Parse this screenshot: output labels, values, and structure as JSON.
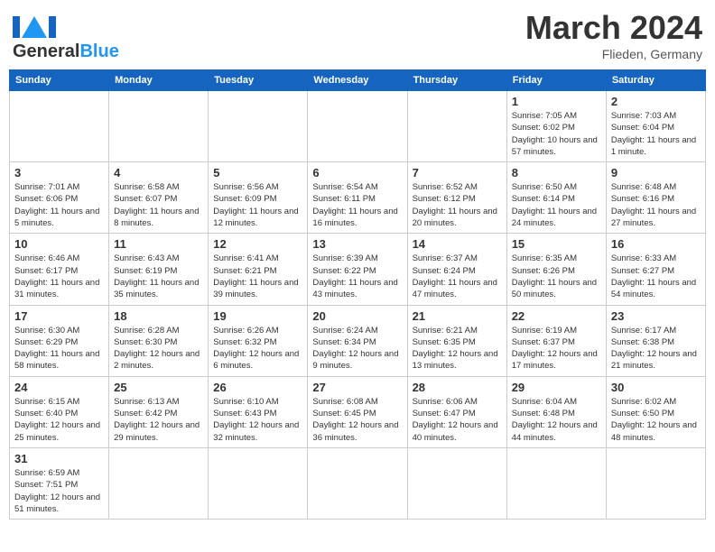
{
  "header": {
    "logo_general": "General",
    "logo_blue": "Blue",
    "month": "March 2024",
    "location": "Flieden, Germany"
  },
  "weekdays": [
    "Sunday",
    "Monday",
    "Tuesday",
    "Wednesday",
    "Thursday",
    "Friday",
    "Saturday"
  ],
  "weeks": [
    [
      {
        "day": "",
        "info": ""
      },
      {
        "day": "",
        "info": ""
      },
      {
        "day": "",
        "info": ""
      },
      {
        "day": "",
        "info": ""
      },
      {
        "day": "",
        "info": ""
      },
      {
        "day": "1",
        "info": "Sunrise: 7:05 AM\nSunset: 6:02 PM\nDaylight: 10 hours and 57 minutes."
      },
      {
        "day": "2",
        "info": "Sunrise: 7:03 AM\nSunset: 6:04 PM\nDaylight: 11 hours and 1 minute."
      }
    ],
    [
      {
        "day": "3",
        "info": "Sunrise: 7:01 AM\nSunset: 6:06 PM\nDaylight: 11 hours and 5 minutes."
      },
      {
        "day": "4",
        "info": "Sunrise: 6:58 AM\nSunset: 6:07 PM\nDaylight: 11 hours and 8 minutes."
      },
      {
        "day": "5",
        "info": "Sunrise: 6:56 AM\nSunset: 6:09 PM\nDaylight: 11 hours and 12 minutes."
      },
      {
        "day": "6",
        "info": "Sunrise: 6:54 AM\nSunset: 6:11 PM\nDaylight: 11 hours and 16 minutes."
      },
      {
        "day": "7",
        "info": "Sunrise: 6:52 AM\nSunset: 6:12 PM\nDaylight: 11 hours and 20 minutes."
      },
      {
        "day": "8",
        "info": "Sunrise: 6:50 AM\nSunset: 6:14 PM\nDaylight: 11 hours and 24 minutes."
      },
      {
        "day": "9",
        "info": "Sunrise: 6:48 AM\nSunset: 6:16 PM\nDaylight: 11 hours and 27 minutes."
      }
    ],
    [
      {
        "day": "10",
        "info": "Sunrise: 6:46 AM\nSunset: 6:17 PM\nDaylight: 11 hours and 31 minutes."
      },
      {
        "day": "11",
        "info": "Sunrise: 6:43 AM\nSunset: 6:19 PM\nDaylight: 11 hours and 35 minutes."
      },
      {
        "day": "12",
        "info": "Sunrise: 6:41 AM\nSunset: 6:21 PM\nDaylight: 11 hours and 39 minutes."
      },
      {
        "day": "13",
        "info": "Sunrise: 6:39 AM\nSunset: 6:22 PM\nDaylight: 11 hours and 43 minutes."
      },
      {
        "day": "14",
        "info": "Sunrise: 6:37 AM\nSunset: 6:24 PM\nDaylight: 11 hours and 47 minutes."
      },
      {
        "day": "15",
        "info": "Sunrise: 6:35 AM\nSunset: 6:26 PM\nDaylight: 11 hours and 50 minutes."
      },
      {
        "day": "16",
        "info": "Sunrise: 6:33 AM\nSunset: 6:27 PM\nDaylight: 11 hours and 54 minutes."
      }
    ],
    [
      {
        "day": "17",
        "info": "Sunrise: 6:30 AM\nSunset: 6:29 PM\nDaylight: 11 hours and 58 minutes."
      },
      {
        "day": "18",
        "info": "Sunrise: 6:28 AM\nSunset: 6:30 PM\nDaylight: 12 hours and 2 minutes."
      },
      {
        "day": "19",
        "info": "Sunrise: 6:26 AM\nSunset: 6:32 PM\nDaylight: 12 hours and 6 minutes."
      },
      {
        "day": "20",
        "info": "Sunrise: 6:24 AM\nSunset: 6:34 PM\nDaylight: 12 hours and 9 minutes."
      },
      {
        "day": "21",
        "info": "Sunrise: 6:21 AM\nSunset: 6:35 PM\nDaylight: 12 hours and 13 minutes."
      },
      {
        "day": "22",
        "info": "Sunrise: 6:19 AM\nSunset: 6:37 PM\nDaylight: 12 hours and 17 minutes."
      },
      {
        "day": "23",
        "info": "Sunrise: 6:17 AM\nSunset: 6:38 PM\nDaylight: 12 hours and 21 minutes."
      }
    ],
    [
      {
        "day": "24",
        "info": "Sunrise: 6:15 AM\nSunset: 6:40 PM\nDaylight: 12 hours and 25 minutes."
      },
      {
        "day": "25",
        "info": "Sunrise: 6:13 AM\nSunset: 6:42 PM\nDaylight: 12 hours and 29 minutes."
      },
      {
        "day": "26",
        "info": "Sunrise: 6:10 AM\nSunset: 6:43 PM\nDaylight: 12 hours and 32 minutes."
      },
      {
        "day": "27",
        "info": "Sunrise: 6:08 AM\nSunset: 6:45 PM\nDaylight: 12 hours and 36 minutes."
      },
      {
        "day": "28",
        "info": "Sunrise: 6:06 AM\nSunset: 6:47 PM\nDaylight: 12 hours and 40 minutes."
      },
      {
        "day": "29",
        "info": "Sunrise: 6:04 AM\nSunset: 6:48 PM\nDaylight: 12 hours and 44 minutes."
      },
      {
        "day": "30",
        "info": "Sunrise: 6:02 AM\nSunset: 6:50 PM\nDaylight: 12 hours and 48 minutes."
      }
    ],
    [
      {
        "day": "31",
        "info": "Sunrise: 6:59 AM\nSunset: 7:51 PM\nDaylight: 12 hours and 51 minutes."
      },
      {
        "day": "",
        "info": ""
      },
      {
        "day": "",
        "info": ""
      },
      {
        "day": "",
        "info": ""
      },
      {
        "day": "",
        "info": ""
      },
      {
        "day": "",
        "info": ""
      },
      {
        "day": "",
        "info": ""
      }
    ]
  ]
}
